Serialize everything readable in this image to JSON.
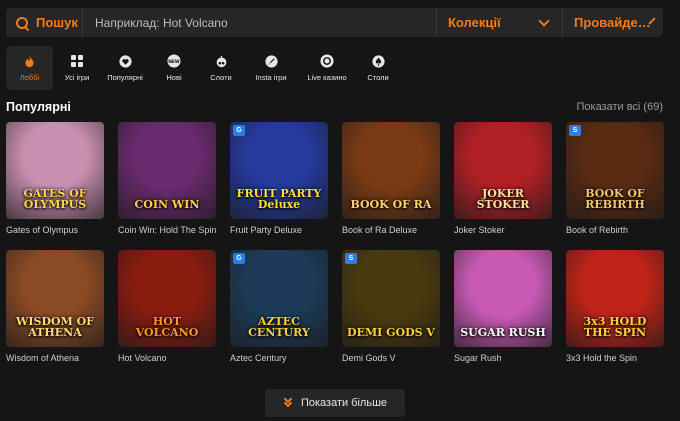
{
  "search": {
    "label": "Пошук",
    "placeholder": "Наприклад: Hot Volcano",
    "value": ""
  },
  "filters": {
    "collections": "Колекції",
    "providers": "Провайде…"
  },
  "categories": [
    {
      "label": "Лоббі",
      "icon": "flame-icon",
      "active": true
    },
    {
      "label": "Усі ігри",
      "icon": "grid-icon",
      "active": false
    },
    {
      "label": "Популярні",
      "icon": "heart-icon",
      "active": false
    },
    {
      "label": "Нові",
      "icon": "new-badge-icon",
      "active": false
    },
    {
      "label": "Слоти",
      "icon": "fruit-icon",
      "active": false
    },
    {
      "label": "Insta ігри",
      "icon": "rocket-icon",
      "active": false
    },
    {
      "label": "Live казино",
      "icon": "chip-icon",
      "active": false
    },
    {
      "label": "Столи",
      "icon": "spade-icon",
      "active": false
    }
  ],
  "section": {
    "title": "Популярні",
    "show_all": "Показати всі (69)"
  },
  "games": [
    {
      "name": "Gates of Olympus",
      "thumb_text": "GATES OF OLYMPUS",
      "bg": "#c98fb0",
      "fg": "#ffd34a",
      "badge": ""
    },
    {
      "name": "Coin Win: Hold The Spin",
      "thumb_text": "COIN WIN",
      "bg": "#6a2a6e",
      "fg": "#ffd23d",
      "badge": ""
    },
    {
      "name": "Fruit Party Deluxe",
      "thumb_text": "FRUIT PARTY Deluxe",
      "bg": "#253a9a",
      "fg": "#ffe03a",
      "badge": "G"
    },
    {
      "name": "Book of Ra Deluxe",
      "thumb_text": "BOOK OF RA",
      "bg": "#7a3a14",
      "fg": "#ffd46b",
      "badge": ""
    },
    {
      "name": "Joker Stoker",
      "thumb_text": "JOKER STOKER",
      "bg": "#b02025",
      "fg": "#ffe2a0",
      "badge": ""
    },
    {
      "name": "Book of Rebirth",
      "thumb_text": "BOOK OF REBIRTH",
      "bg": "#5a2a12",
      "fg": "#f6c66a",
      "badge": "S"
    },
    {
      "name": "Wisdom of Athena",
      "thumb_text": "WISDOM OF ATHENA",
      "bg": "#8a4a24",
      "fg": "#ffd87a",
      "badge": ""
    },
    {
      "name": "Hot Volcano",
      "thumb_text": "HOT VOLCANO",
      "bg": "#8a1c10",
      "fg": "#ff9a2a",
      "badge": ""
    },
    {
      "name": "Aztec Century",
      "thumb_text": "AZTEC CENTURY",
      "bg": "#1d3b58",
      "fg": "#ffd23a",
      "badge": "G"
    },
    {
      "name": "Demi Gods V",
      "thumb_text": "DEMI GODS V",
      "bg": "#4a3a10",
      "fg": "#ffd23a",
      "badge": "S"
    },
    {
      "name": "Sugar Rush",
      "thumb_text": "SUGAR RUSH",
      "bg": "#c85ab5",
      "fg": "#ffffff",
      "badge": ""
    },
    {
      "name": "3x3 Hold the Spin",
      "thumb_text": "3x3 HOLD THE SPIN",
      "bg": "#c02418",
      "fg": "#ffd23a",
      "badge": ""
    }
  ],
  "load_more": "Показати більше",
  "colors": {
    "accent": "#f07c1c",
    "background": "#151515",
    "panel": "#262626"
  }
}
